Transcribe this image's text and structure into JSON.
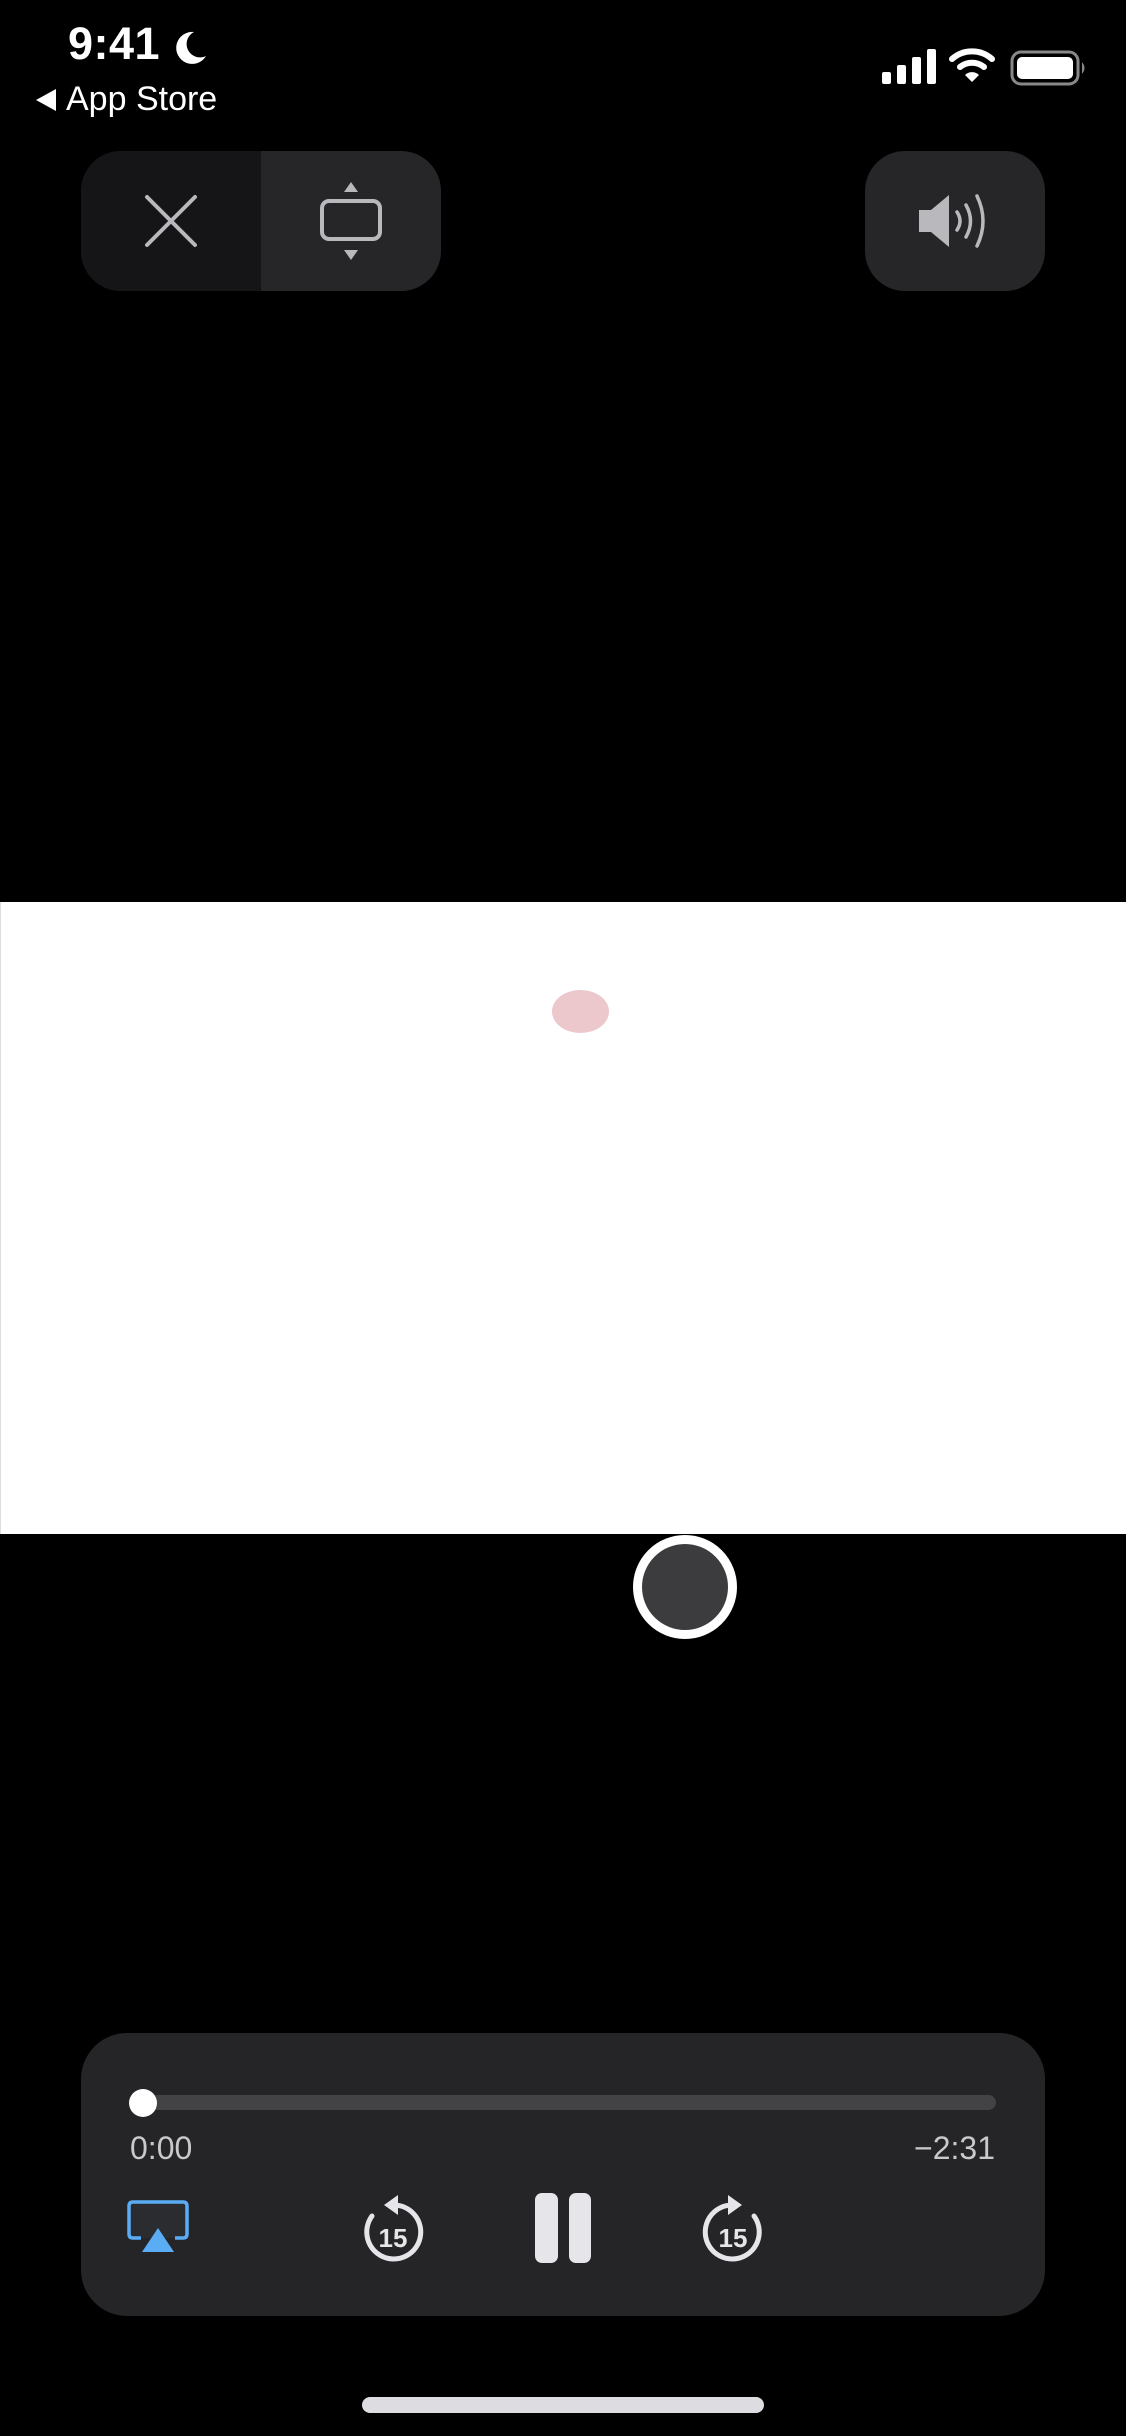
{
  "status_bar": {
    "time": "9:41",
    "focus_icon": "moon-icon",
    "back_label": "App Store",
    "signal_icon": "cellular-signal-icon",
    "wifi_icon": "wifi-icon",
    "battery_icon": "battery-icon"
  },
  "top_controls": {
    "close_icon": "close-icon",
    "resize_icon": "aspect-fill-icon",
    "volume_icon": "speaker-volume-icon"
  },
  "video": {
    "background": "#ffffff",
    "dot_color": "#ecc8cc"
  },
  "playback": {
    "elapsed": "0:00",
    "remaining": "−2:31",
    "progress": 0,
    "airplay_color": "#5aadf5",
    "airplay_icon": "airplay-icon",
    "skip_back_seconds": "15",
    "skip_forward_seconds": "15",
    "play_state_icon": "pause-icon"
  }
}
